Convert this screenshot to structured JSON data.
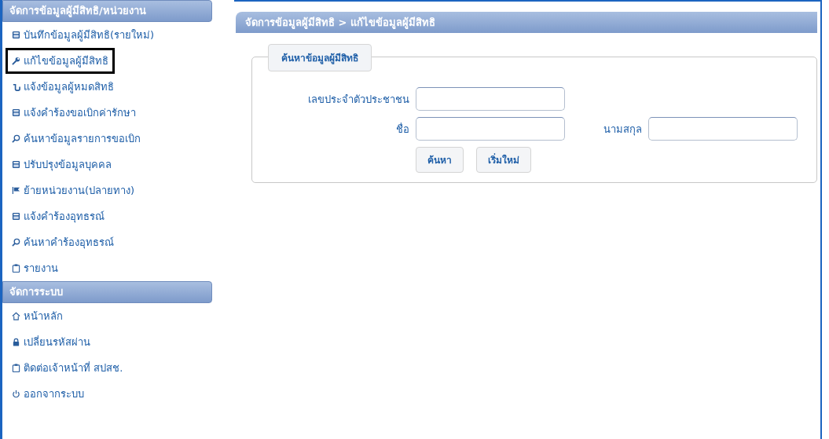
{
  "sidebar": {
    "sections": [
      {
        "title": "จัดการข้อมูลผู้มีสิทธิ/หน่วยงาน",
        "items": [
          {
            "label": "บันทึกข้อมูลผู้มีสิทธิ(รายใหม่)",
            "kind": "calc",
            "selected": false
          },
          {
            "label": "แก้ไขข้อมูลผู้มีสิทธิ",
            "kind": "wrench",
            "selected": true
          },
          {
            "label": "แจ้งข้อมูลผู้หมดสิทธิ",
            "kind": "hook",
            "selected": false
          },
          {
            "label": "แจ้งคำร้องขอเบิกค่ารักษา",
            "kind": "calc",
            "selected": false
          },
          {
            "label": "ค้นหาข้อมูลรายการขอเบิก",
            "kind": "search",
            "selected": false
          },
          {
            "label": "ปรับปรุงข้อมูลบุคคล",
            "kind": "calc",
            "selected": false
          },
          {
            "label": "ย้ายหน่วยงาน(ปลายทาง)",
            "kind": "flag",
            "selected": false
          },
          {
            "label": "แจ้งคำร้องอุทธรณ์",
            "kind": "calc",
            "selected": false
          },
          {
            "label": "ค้นหาคำร้องอุทธรณ์",
            "kind": "search",
            "selected": false
          },
          {
            "label": "รายงาน",
            "kind": "clipboard",
            "selected": false
          }
        ]
      },
      {
        "title": "จัดการระบบ",
        "items": [
          {
            "label": "หน้าหลัก",
            "kind": "home",
            "selected": false
          },
          {
            "label": "เปลี่ยนรหัสผ่าน",
            "kind": "lock",
            "selected": false
          },
          {
            "label": "ติดต่อเจ้าหน้าที่ สปสช.",
            "kind": "clipboard",
            "selected": false
          },
          {
            "label": "ออกจากระบบ",
            "kind": "power",
            "selected": false
          }
        ]
      }
    ]
  },
  "main": {
    "breadcrumb": "จัดการข้อมูลผู้มีสิทธิ > แก้ไขข้อมูลผู้มีสิทธิ",
    "search_form": {
      "legend": "ค้นหาข้อมูลผู้มีสิทธิ",
      "id_label": "เลขประจำตัวประชาชน",
      "name_label": "ชื่อ",
      "surname_label": "นามสกุล",
      "buttons": [
        "ค้นหา",
        "เริ่มใหม่"
      ]
    }
  }
}
